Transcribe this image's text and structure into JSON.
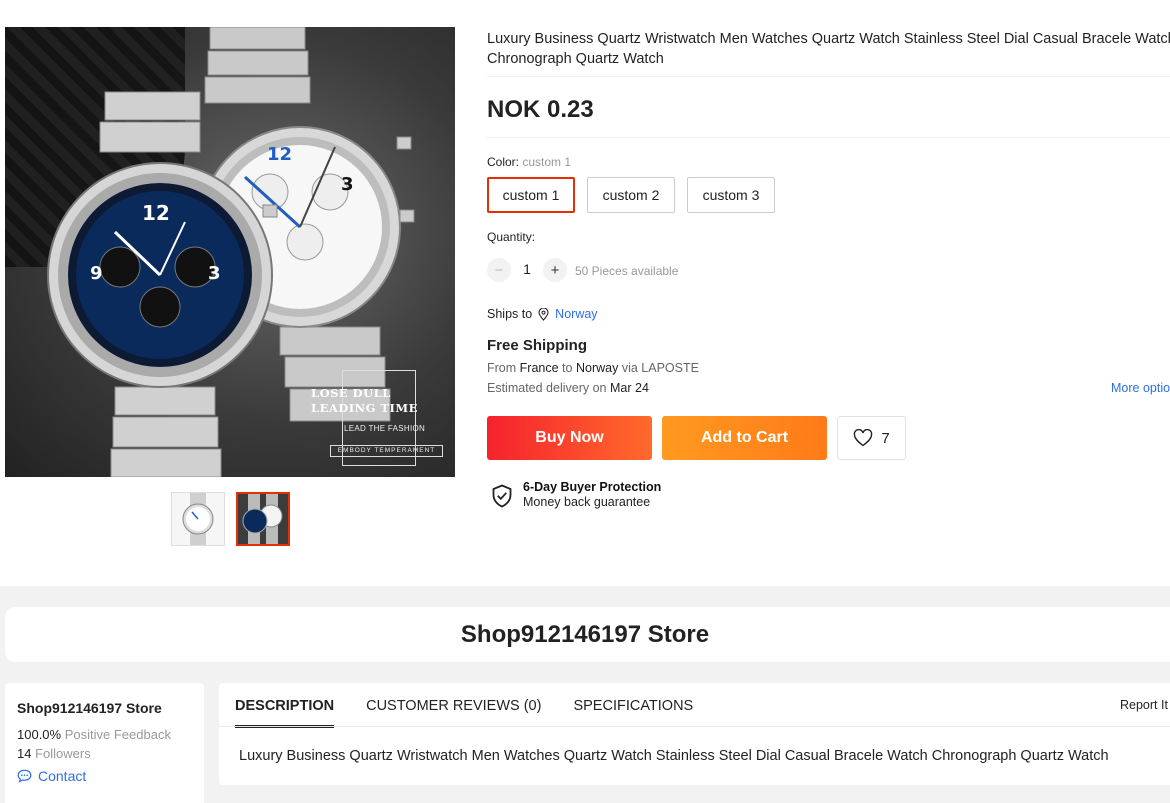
{
  "product": {
    "title": "Luxury Business Quartz Wristwatch Men Watches Quartz Watch Stainless Steel Dial Casual Bracele Watch Chronograph Quartz Watch",
    "price": "NOK 0.23",
    "image_overlay": {
      "line1": "LOSE DULL",
      "line2": "LEADING TIME",
      "line3": "LEAD THE FASHION",
      "line4": "EMBODY TEMPERAMENT"
    }
  },
  "color": {
    "label": "Color:",
    "selected": "custom 1",
    "options": [
      "custom 1",
      "custom 2",
      "custom 3"
    ]
  },
  "quantity": {
    "label": "Quantity:",
    "minus": "−",
    "plus": "+",
    "value": "1",
    "available": "50 Pieces available"
  },
  "shipping": {
    "ships_to_label": "Ships to",
    "country": "Norway",
    "free_title": "Free Shipping",
    "from_prefix": "From",
    "from_country": "France",
    "to_word": "to",
    "to_country": "Norway",
    "via_word": "via",
    "carrier": "LAPOSTE",
    "estimated_prefix": "Estimated delivery on",
    "estimated_date": "Mar 24",
    "more_options": "More optio"
  },
  "actions": {
    "buy_now": "Buy Now",
    "add_to_cart": "Add to Cart",
    "wishlist_count": "7"
  },
  "protection": {
    "title": "6-Day Buyer Protection",
    "subtitle": "Money back guarantee"
  },
  "store": {
    "banner_name": "Shop912146197 Store",
    "name": "Shop912146197 Store",
    "feedback_value": "100.0%",
    "feedback_label": "Positive Feedback",
    "followers_value": "14",
    "followers_label": "Followers",
    "contact": "Contact"
  },
  "tabs": {
    "items": [
      "DESCRIPTION",
      "CUSTOMER REVIEWS (0)",
      "SPECIFICATIONS"
    ],
    "active": "DESCRIPTION",
    "report": "Report It"
  },
  "description": {
    "text": "Luxury Business Quartz Wristwatch Men Watches Quartz Watch Stainless Steel Dial Casual Bracele Watch Chronograph Quartz Watch"
  },
  "colors": {
    "accent_red": "#e62e04",
    "buy_gradient_start": "#f5222d",
    "cart_orange": "#ff9a1f",
    "link_blue": "#2f6fe4"
  },
  "icons": [
    "location-pin-icon",
    "heart-icon",
    "shield-check-icon",
    "chat-icon",
    "minus-icon",
    "plus-icon"
  ]
}
